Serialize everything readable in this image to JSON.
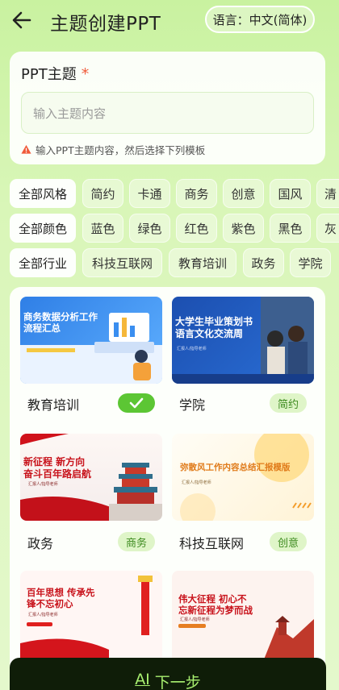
{
  "header": {
    "title": "主题创建PPT",
    "language_label": "语言：中文(简体)"
  },
  "topic": {
    "label": "PPT主题",
    "required_mark": "*",
    "placeholder": "输入主题内容",
    "hint": "输入PPT主题内容，然后选择下列模板"
  },
  "filters": {
    "style": {
      "all": "全部风格",
      "options": [
        "简约",
        "卡通",
        "商务",
        "创意",
        "国风",
        "清"
      ]
    },
    "color": {
      "all": "全部颜色",
      "options": [
        "蓝色",
        "绿色",
        "红色",
        "紫色",
        "黑色",
        "灰"
      ]
    },
    "industry": {
      "all": "全部行业",
      "options": [
        "科技互联网",
        "教育培训",
        "政务",
        "学院"
      ]
    }
  },
  "templates": [
    {
      "name": "教育培训",
      "tag": "",
      "selected": true,
      "thumb_title": "商务数据分析工作\n流程汇总",
      "thumb_sub": ""
    },
    {
      "name": "学院",
      "tag": "简约",
      "selected": false,
      "thumb_title": "大学生毕业策划书\n语言文化交流周",
      "thumb_sub": "汇报人/指导老师"
    },
    {
      "name": "政务",
      "tag": "商务",
      "selected": false,
      "thumb_title": "新征程 新方向\n奋斗百年路启航",
      "thumb_sub": "汇报人/指导老师"
    },
    {
      "name": "科技互联网",
      "tag": "创意",
      "selected": false,
      "thumb_title": "弥散风工作内容总结汇报模版",
      "thumb_sub": "汇报人/指导老师"
    },
    {
      "name": "",
      "tag": "",
      "selected": false,
      "thumb_title": "百年思想 传承先\n锋不忘初心",
      "thumb_sub": "汇报人/指导老师"
    },
    {
      "name": "",
      "tag": "",
      "selected": false,
      "thumb_title": "伟大征程 初心不\n忘新征程为梦而战",
      "thumb_sub": "汇报人/指导老师"
    }
  ],
  "cta": {
    "ai_mark": "AI",
    "label": "下一步"
  },
  "colors": {
    "accent": "#5cc634",
    "tag_text": "#3d8b1f",
    "cta_bg": "#0f1d08",
    "cta_text": "#a8f070"
  }
}
